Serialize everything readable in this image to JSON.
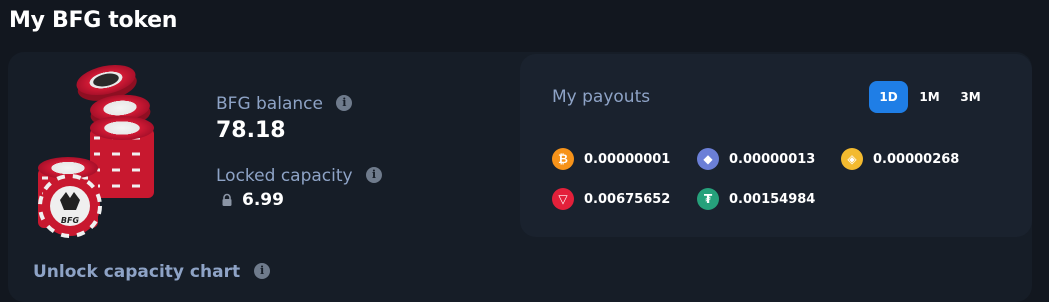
{
  "page": {
    "title": "My BFG token"
  },
  "balance": {
    "label": "BFG balance",
    "value": "78.18",
    "info_icon": "i"
  },
  "locked": {
    "label": "Locked capacity",
    "value": "6.99",
    "info_icon": "i"
  },
  "unlock_chart": {
    "label": "Unlock capacity chart",
    "info_icon": "i"
  },
  "payouts": {
    "title": "My payouts",
    "tabs": [
      {
        "label": "1D",
        "active": true
      },
      {
        "label": "1M",
        "active": false
      },
      {
        "label": "3M",
        "active": false
      }
    ],
    "coins": [
      {
        "icon": "bitcoin-icon",
        "glyph": "₿",
        "color": "#f7931a",
        "amount": "0.00000001"
      },
      {
        "icon": "ethereum-icon",
        "glyph": "◆",
        "color": "#6b7fd7",
        "amount": "0.00000013"
      },
      {
        "icon": "bnb-icon",
        "glyph": "◈",
        "color": "#f3ba2f",
        "amount": "0.00000268"
      },
      {
        "icon": "tron-icon",
        "glyph": "▽",
        "color": "#e3203a",
        "amount": "0.00675652"
      },
      {
        "icon": "tether-icon",
        "glyph": "₮",
        "color": "#26a17b",
        "amount": "0.00154984"
      }
    ]
  },
  "colors": {
    "background": "#12171f",
    "card": "#161d27",
    "payouts_panel": "#1a222e",
    "label": "#8ea3c6",
    "active_tab": "#1f7ee6",
    "chip_red": "#e01e3c"
  }
}
